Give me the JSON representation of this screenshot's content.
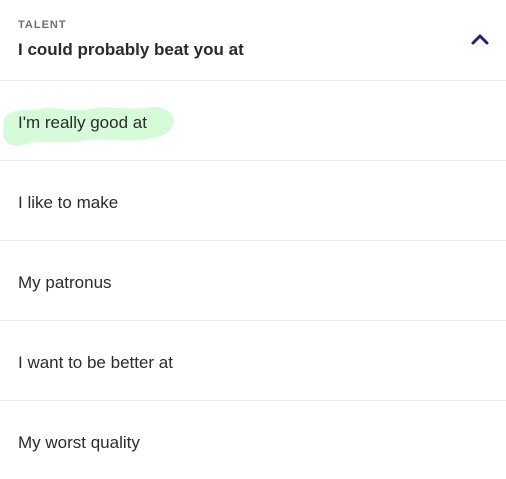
{
  "prompt_card": {
    "category": "TALENT",
    "title": "I could probably beat you at",
    "toggle_icon": "chevron-up-icon",
    "accent_color": "#1a237e",
    "highlight_color": "#d6fbd9"
  },
  "options": [
    {
      "label": "I'm really good at",
      "highlighted": true
    },
    {
      "label": "I like to make",
      "highlighted": false
    },
    {
      "label": "My patronus",
      "highlighted": false
    },
    {
      "label": "I want to be better at",
      "highlighted": false
    },
    {
      "label": "My worst quality",
      "highlighted": false
    }
  ]
}
